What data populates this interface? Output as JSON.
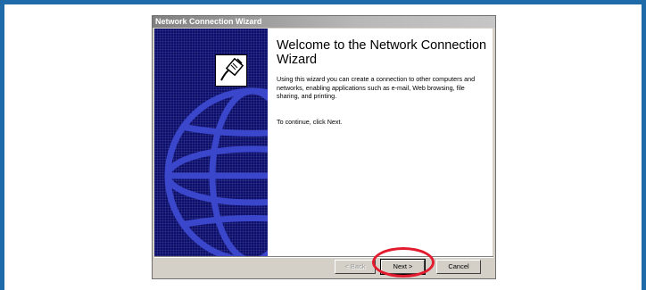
{
  "window": {
    "title": "Network Connection Wizard"
  },
  "content": {
    "heading": "Welcome to the Network Connection Wizard",
    "intro": "Using this wizard you can create a connection to other computers and networks, enabling applications such as e-mail, Web browsing, file sharing, and printing.",
    "continue_text": "To continue, click Next."
  },
  "buttons": {
    "back": "< Back",
    "next": "Next >",
    "cancel": "Cancel"
  },
  "side_panel": {
    "icon": "network-plug-icon",
    "graphic": "globe"
  },
  "colors": {
    "frame_border": "#1f6aa8",
    "side_panel": "#0c0e6e",
    "globe_lines": "#3d4ad0",
    "highlight": "#e21b2e",
    "dialog_face": "#d4d0c8"
  },
  "state": {
    "back_enabled": false,
    "highlighted_button": "next"
  }
}
